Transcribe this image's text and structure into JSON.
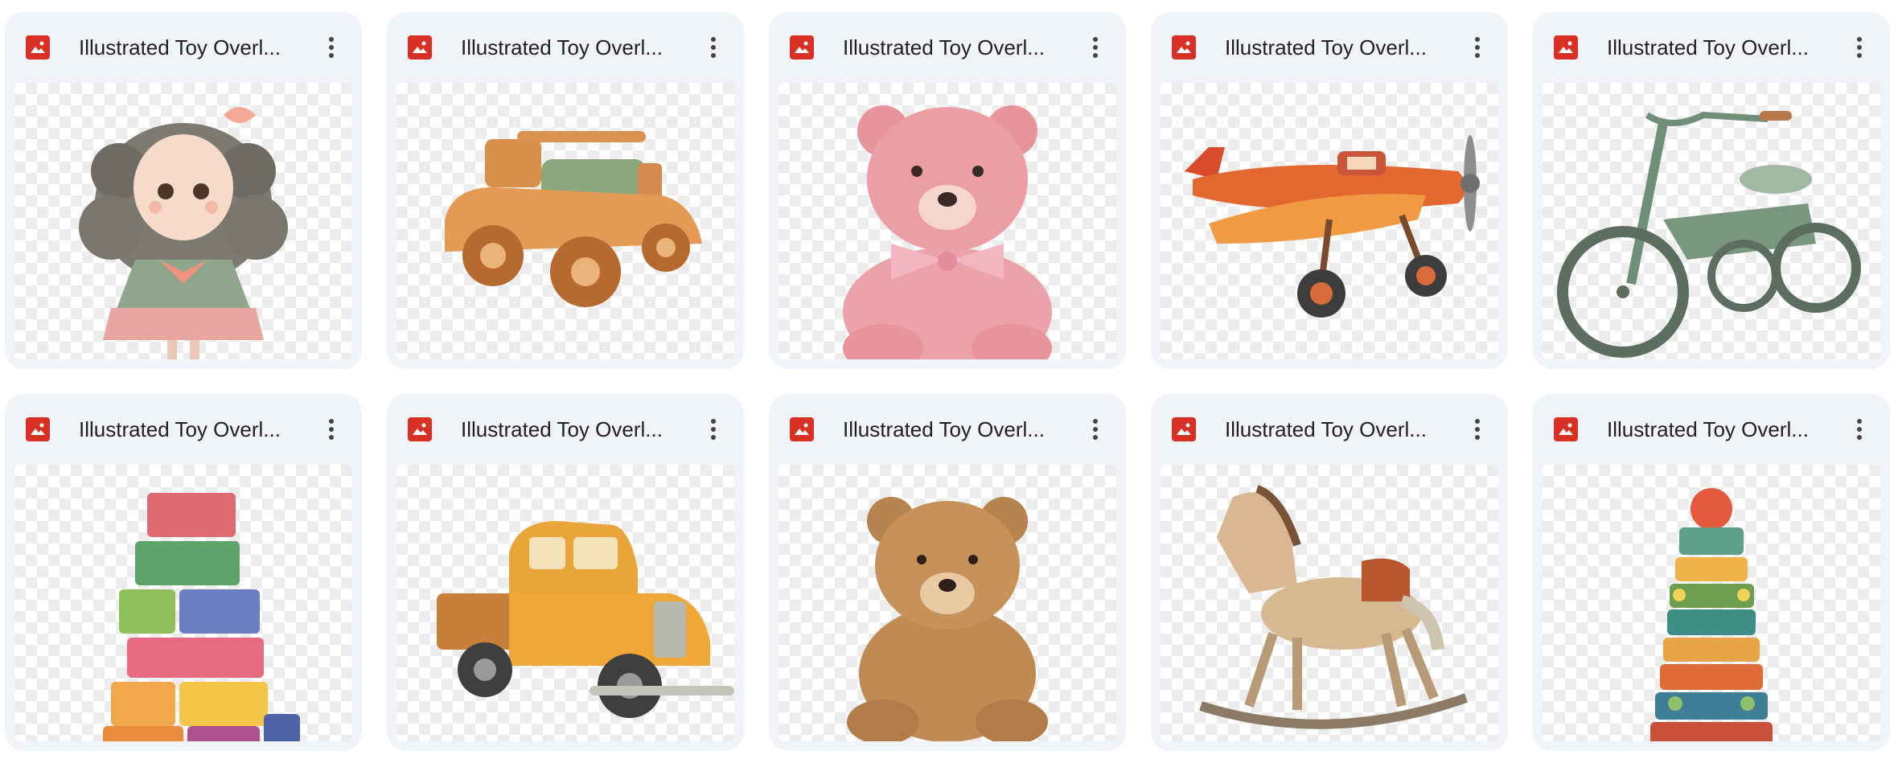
{
  "files": [
    {
      "title": "Illustrated Toy Overl...",
      "icon": "image-file-icon",
      "thumbnail": "curly-haired-doll"
    },
    {
      "title": "Illustrated Toy Overl...",
      "icon": "image-file-icon",
      "thumbnail": "wooden-toy-car"
    },
    {
      "title": "Illustrated Toy Overl...",
      "icon": "image-file-icon",
      "thumbnail": "pink-teddy-bear"
    },
    {
      "title": "Illustrated Toy Overl...",
      "icon": "image-file-icon",
      "thumbnail": "red-toy-airplane"
    },
    {
      "title": "Illustrated Toy Overl...",
      "icon": "image-file-icon",
      "thumbnail": "green-tricycle"
    },
    {
      "title": "Illustrated Toy Overl...",
      "icon": "image-file-icon",
      "thumbnail": "stacked-blocks"
    },
    {
      "title": "Illustrated Toy Overl...",
      "icon": "image-file-icon",
      "thumbnail": "yellow-pickup-truck"
    },
    {
      "title": "Illustrated Toy Overl...",
      "icon": "image-file-icon",
      "thumbnail": "brown-teddy-bear"
    },
    {
      "title": "Illustrated Toy Overl...",
      "icon": "image-file-icon",
      "thumbnail": "rocking-horse"
    },
    {
      "title": "Illustrated Toy Overl...",
      "icon": "image-file-icon",
      "thumbnail": "stacking-tower-toy"
    }
  ],
  "colors": {
    "card_bg": "#f0f4f9",
    "image_icon": "#d93025",
    "text": "#1f1f1f"
  }
}
